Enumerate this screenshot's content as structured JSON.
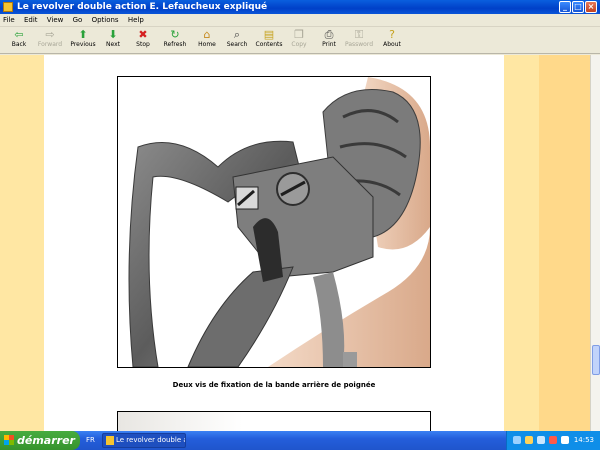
{
  "window": {
    "title": "Le revolver double action E. Lefaucheux expliqué"
  },
  "menu": [
    "File",
    "Edit",
    "View",
    "Go",
    "Options",
    "Help"
  ],
  "toolbar": [
    {
      "label": "Back",
      "icon": "back-arrow-icon",
      "glyph": "⇦",
      "color": "#2aa23a",
      "enabled": true
    },
    {
      "label": "Forward",
      "icon": "forward-arrow-icon",
      "glyph": "⇨",
      "color": "#a7a596",
      "enabled": false
    },
    {
      "label": "Previous",
      "icon": "up-arrow-icon",
      "glyph": "⬆",
      "color": "#2aa23a",
      "enabled": true
    },
    {
      "label": "Next",
      "icon": "down-arrow-icon",
      "glyph": "⬇",
      "color": "#2aa23a",
      "enabled": true
    },
    {
      "label": "Stop",
      "icon": "stop-icon",
      "glyph": "✖",
      "color": "#d52020",
      "enabled": true
    },
    {
      "label": "Refresh",
      "icon": "refresh-icon",
      "glyph": "↻",
      "color": "#2aa23a",
      "enabled": true
    },
    {
      "label": "Home",
      "icon": "home-icon",
      "glyph": "⌂",
      "color": "#c68a1e",
      "enabled": true
    },
    {
      "label": "Search",
      "icon": "search-icon",
      "glyph": "⌕",
      "color": "#444444",
      "enabled": true
    },
    {
      "label": "Contents",
      "icon": "contents-icon",
      "glyph": "▤",
      "color": "#c6a21e",
      "enabled": true
    },
    {
      "label": "Copy",
      "icon": "copy-icon",
      "glyph": "❐",
      "color": "#a7a596",
      "enabled": false
    },
    {
      "label": "Print",
      "icon": "print-icon",
      "glyph": "⎙",
      "color": "#444444",
      "enabled": true
    },
    {
      "label": "Password",
      "icon": "key-icon",
      "glyph": "⚿",
      "color": "#a7a596",
      "enabled": false
    },
    {
      "label": "About",
      "icon": "help-icon",
      "glyph": "?",
      "color": "#c6a21e",
      "enabled": true
    }
  ],
  "content": {
    "caption": "Deux vis de fixation de la bande arrière de poignée"
  },
  "taskbar": {
    "start_label": "démarrer",
    "language": "FR",
    "task_label": "Le revolver double ac...",
    "clock": "14:53"
  }
}
